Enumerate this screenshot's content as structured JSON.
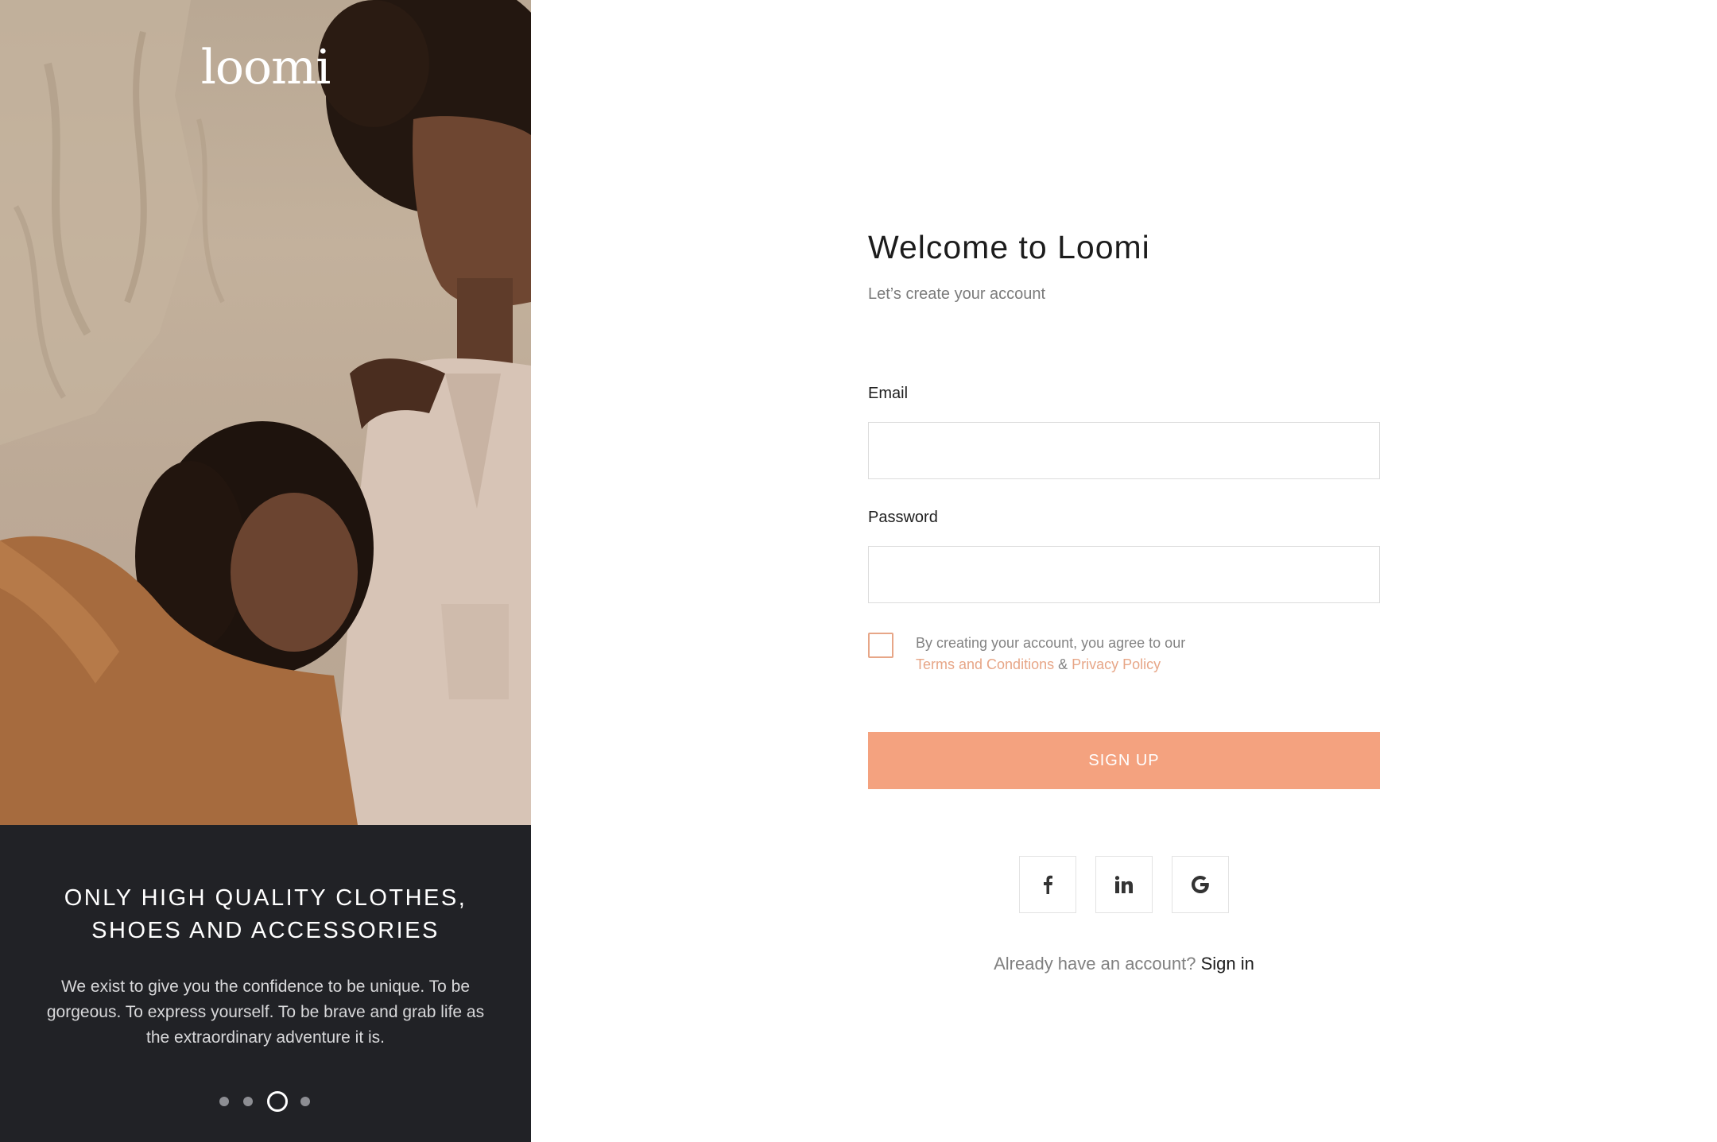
{
  "brand": {
    "logo_text": "loomi"
  },
  "promo": {
    "title_line1": "ONLY HIGH QUALITY CLOTHES,",
    "title_line2": "SHOES AND ACCESSORIES",
    "body": "We exist to give you the confidence to be unique. To be gorgeous. To express yourself. To be brave and grab life as the extraordinary adventure it is."
  },
  "carousel": {
    "slide_count": 4,
    "active_index": 2
  },
  "form": {
    "title": "Welcome to Loomi",
    "subtitle": "Let’s create your account",
    "email_label": "Email",
    "email_value": "",
    "password_label": "Password",
    "password_value": "",
    "agree_checked": false,
    "terms_prefix": "By creating your account, you agree to our",
    "terms_link": "Terms and Conditions",
    "terms_and": "&",
    "privacy_link": "Privacy Policy",
    "signup_label": "SIGN UP"
  },
  "social": [
    {
      "icon": "facebook-icon",
      "glyph": "f"
    },
    {
      "icon": "linkedin-icon",
      "glyph": "in"
    },
    {
      "icon": "google-icon",
      "glyph": "G"
    }
  ],
  "signin": {
    "prompt": "Already have an account?",
    "link": "Sign in"
  },
  "colors": {
    "accent": "#f4a27f",
    "accent_text": "#e7a687",
    "dark_panel": "#212226",
    "text_dark": "#1c1c1c",
    "text_muted": "#7b7b7b",
    "border": "#dcdcdc"
  }
}
